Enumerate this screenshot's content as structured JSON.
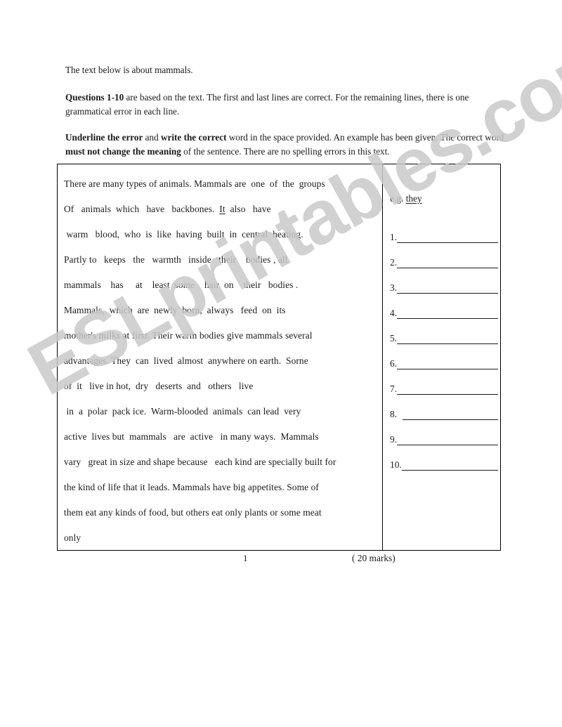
{
  "document": {
    "intro": {
      "line1": "The text below is about mammals.",
      "para2_bold": "Questions 1-10",
      "para2_rest": " are based on the text. The first and last lines are correct. For the remaining lines, there is one grammatical error in each line.",
      "para3_bold1": "Underline the error",
      "para3_mid1": " and ",
      "para3_bold2": "write the correct",
      "para3_mid2": " word in the space provided. An example has been given. The correct word ",
      "para3_bold3": "must not change the meaning",
      "para3_end": " of the sentence. There are no spelling errors in this text."
    },
    "passage": {
      "lines": [
        {
          "pre": "There are many types of animals. Mammals are  one  of  the  groups",
          "underline": "",
          "post": ""
        },
        {
          "pre": "Of   animals  which   have   backbones.  ",
          "underline": "It",
          "post": "  also   have"
        },
        {
          "pre": " warm   blood,  who  is  like  having  built  in  central  heating.",
          "underline": "",
          "post": ""
        },
        {
          "pre": "Partly to   keeps   the   warmth   inside   their    bodies , all",
          "underline": "",
          "post": ""
        },
        {
          "pre": "mammals    has     at    least  some    hair  on    their   bodies .",
          "underline": "",
          "post": ""
        },
        {
          "pre": "Mammals,  which  are  newly  born,  always   feed  on  its",
          "underline": "",
          "post": ""
        },
        {
          "pre": "mother's milks at first. Their warm bodies give mammals several",
          "underline": "",
          "post": ""
        },
        {
          "pre": "advantages. They  can  lived  almost  anywhere on earth.  Sorne",
          "underline": "",
          "post": ""
        },
        {
          "pre": "of  it   live in hot,  dry   deserts  and   others   live",
          "underline": "",
          "post": ""
        },
        {
          "pre": " in  a  polar  pack ice.  Warm-blooded  animals  can lead  very",
          "underline": "",
          "post": ""
        },
        {
          "pre": "active  lives but  mammals   are  active   in many ways.  Mammals",
          "underline": "",
          "post": ""
        },
        {
          "pre": "vary   great in size and shape because   each kind are specially built for",
          "underline": "",
          "post": ""
        },
        {
          "pre": "the kind of life that it leads. Mammals have big appetites. Some of",
          "underline": "",
          "post": ""
        },
        {
          "pre": "them eat any kinds of food, but others eat only plants or some meat",
          "underline": "",
          "post": ""
        },
        {
          "pre": "only",
          "underline": "",
          "post": ""
        }
      ]
    },
    "answers": {
      "example_prefix": "e.g. ",
      "example_word": "they",
      "items": [
        {
          "number": "1."
        },
        {
          "number": "2."
        },
        {
          "number": "3."
        },
        {
          "number": "4."
        },
        {
          "number": "5."
        },
        {
          "number": "6."
        },
        {
          "number": "7."
        },
        {
          "number": "8. "
        },
        {
          "number": "9."
        },
        {
          "number": "10."
        }
      ]
    },
    "footer": {
      "page_number": "1",
      "marks": "( 20 marks)"
    },
    "watermark": {
      "text": "ESLprintables.com",
      "color": "#c9c9c9"
    }
  }
}
